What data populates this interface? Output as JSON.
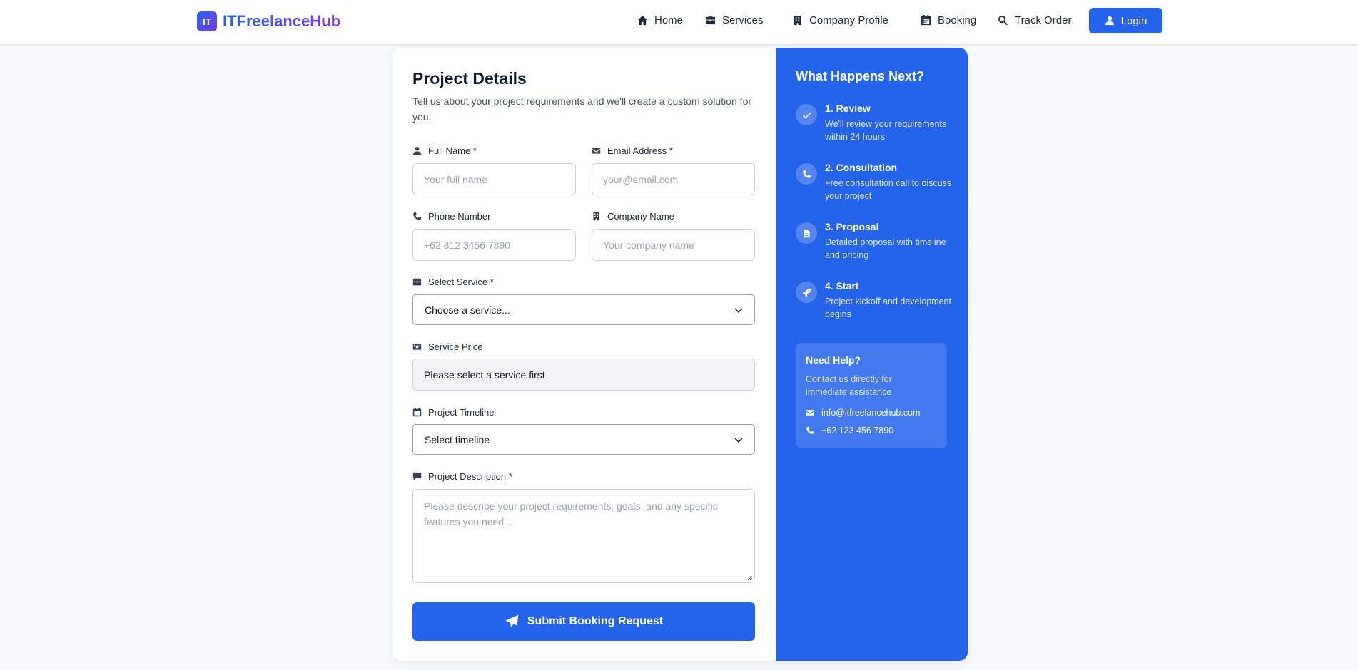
{
  "nav": {
    "brand_badge": "IT",
    "brand_name": "ITFreelanceHub",
    "items": [
      {
        "label": "Home",
        "icon": "home-icon"
      },
      {
        "label": "Services",
        "icon": "briefcase-icon"
      },
      {
        "label": "Company Profile",
        "icon": "building-icon"
      },
      {
        "label": "Booking",
        "icon": "calendar-icon"
      },
      {
        "label": "Track Order",
        "icon": "search-icon"
      }
    ],
    "login": "Login"
  },
  "form": {
    "title": "Project Details",
    "subtitle": "Tell us about your project requirements and we'll create a custom solution for you.",
    "full_name": {
      "label": "Full Name *",
      "placeholder": "Your full name"
    },
    "email": {
      "label": "Email Address *",
      "placeholder": "your@email.com"
    },
    "phone": {
      "label": "Phone Number",
      "placeholder": "+62 812 3456 7890"
    },
    "company": {
      "label": "Company Name",
      "placeholder": "Your company name"
    },
    "service": {
      "label": "Select Service *",
      "selected": "Choose a service..."
    },
    "price": {
      "label": "Service Price",
      "value": "Please select a service first"
    },
    "timeline": {
      "label": "Project Timeline",
      "selected": "Select timeline"
    },
    "description": {
      "label": "Project Description *",
      "placeholder": "Please describe your project requirements, goals, and any specific features you need..."
    },
    "submit": "Submit Booking Request"
  },
  "sidebar": {
    "title": "What Happens Next?",
    "steps": [
      {
        "title": "1. Review",
        "desc": "We'll review your requirements within 24 hours",
        "icon": "check-icon"
      },
      {
        "title": "2. Consultation",
        "desc": "Free consultation call to discuss your project",
        "icon": "phone-icon"
      },
      {
        "title": "3. Proposal",
        "desc": "Detailed proposal with timeline and pricing",
        "icon": "document-icon"
      },
      {
        "title": "4. Start",
        "desc": "Project kickoff and development begins",
        "icon": "rocket-icon"
      }
    ],
    "help": {
      "title": "Need Help?",
      "desc": "Contact us directly for immediate assistance",
      "email": "info@itfreelancehub.com",
      "phone": "+62 123 456 7890"
    }
  },
  "colors": {
    "primary": "#2563eb",
    "accent": "#7c3aed",
    "background": "#f8fafc"
  }
}
